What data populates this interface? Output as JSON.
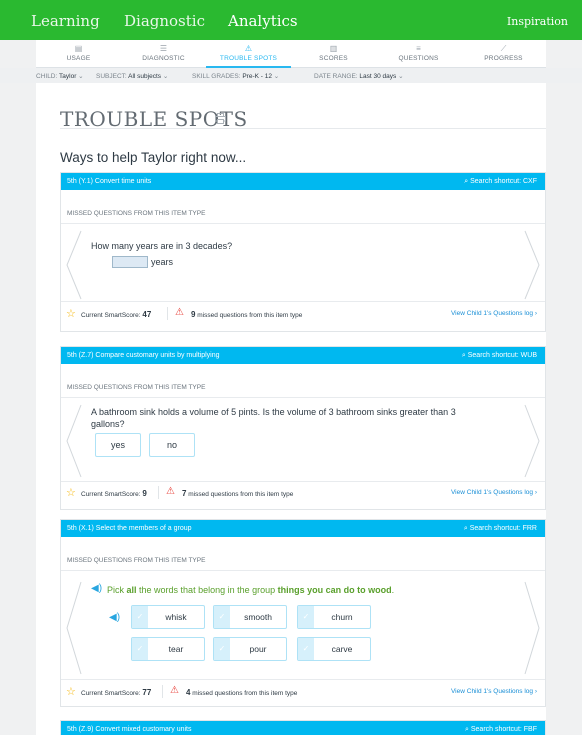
{
  "topnav": {
    "items": [
      "Learning",
      "Diagnostic",
      "Analytics"
    ],
    "active": "Analytics",
    "right": "Inspiration"
  },
  "subnav": {
    "tabs": [
      {
        "label": "USAGE",
        "icon": "clipboard-icon"
      },
      {
        "label": "DIAGNOSTIC",
        "icon": "sliders-icon"
      },
      {
        "label": "TROUBLE SPOTS",
        "icon": "warning-icon"
      },
      {
        "label": "SCORES",
        "icon": "building-icon"
      },
      {
        "label": "QUESTIONS",
        "icon": "list-icon"
      },
      {
        "label": "PROGRESS",
        "icon": "line-chart-icon"
      }
    ],
    "active": "TROUBLE SPOTS"
  },
  "filters": {
    "child_key": "CHILD:",
    "child_val": "Taylor",
    "subject_key": "SUBJECT:",
    "subject_val": "All subjects",
    "grades_key": "SKILL GRADES:",
    "grades_val": "Pre-K - 12",
    "range_key": "DATE RANGE:",
    "range_val": "Last 30 days"
  },
  "page": {
    "title": "TROUBLE SPOTS",
    "subtitle": "Ways to help Taylor right now..."
  },
  "common": {
    "missed_label": "MISSED QUESTIONS FROM THIS ITEM TYPE",
    "smartscore_label": "Current SmartScore:",
    "missed_suffix": "missed questions from this item type",
    "log_link": "View Child 1's Questions log ›"
  },
  "cards": [
    {
      "title": "5th (Y.1)  Convert time units",
      "shortcut": "Search shortcut: CXF",
      "question": "How many years are in 3 decades?",
      "answer_unit": "years",
      "smartscore": "47",
      "missed_count": "9"
    },
    {
      "title": "5th (Z.7)  Compare customary units by multiplying",
      "shortcut": "Search shortcut: WUB",
      "question": "A bathroom sink holds a volume of 5 pints. Is the volume of 3 bathroom sinks greater than 3 gallons?",
      "options": [
        "yes",
        "no"
      ],
      "smartscore": "9",
      "missed_count": "7"
    },
    {
      "title": "5th (X.1)  Select the members of a group",
      "shortcut": "Search shortcut: FRR",
      "q_pre": "Pick ",
      "q_bold1": "all",
      "q_mid": " the words that belong in the group ",
      "q_bold2": "things you can do to wood",
      "q_end": ".",
      "words": [
        "whisk",
        "smooth",
        "churn",
        "tear",
        "pour",
        "carve"
      ],
      "smartscore": "77",
      "missed_count": "4"
    },
    {
      "title": "5th (Z.9)  Convert mixed customary units",
      "shortcut": "Search shortcut: FBF"
    }
  ],
  "colors": {
    "green": "#2ab930",
    "blue": "#00b8f0",
    "link": "#1a8fd6"
  }
}
